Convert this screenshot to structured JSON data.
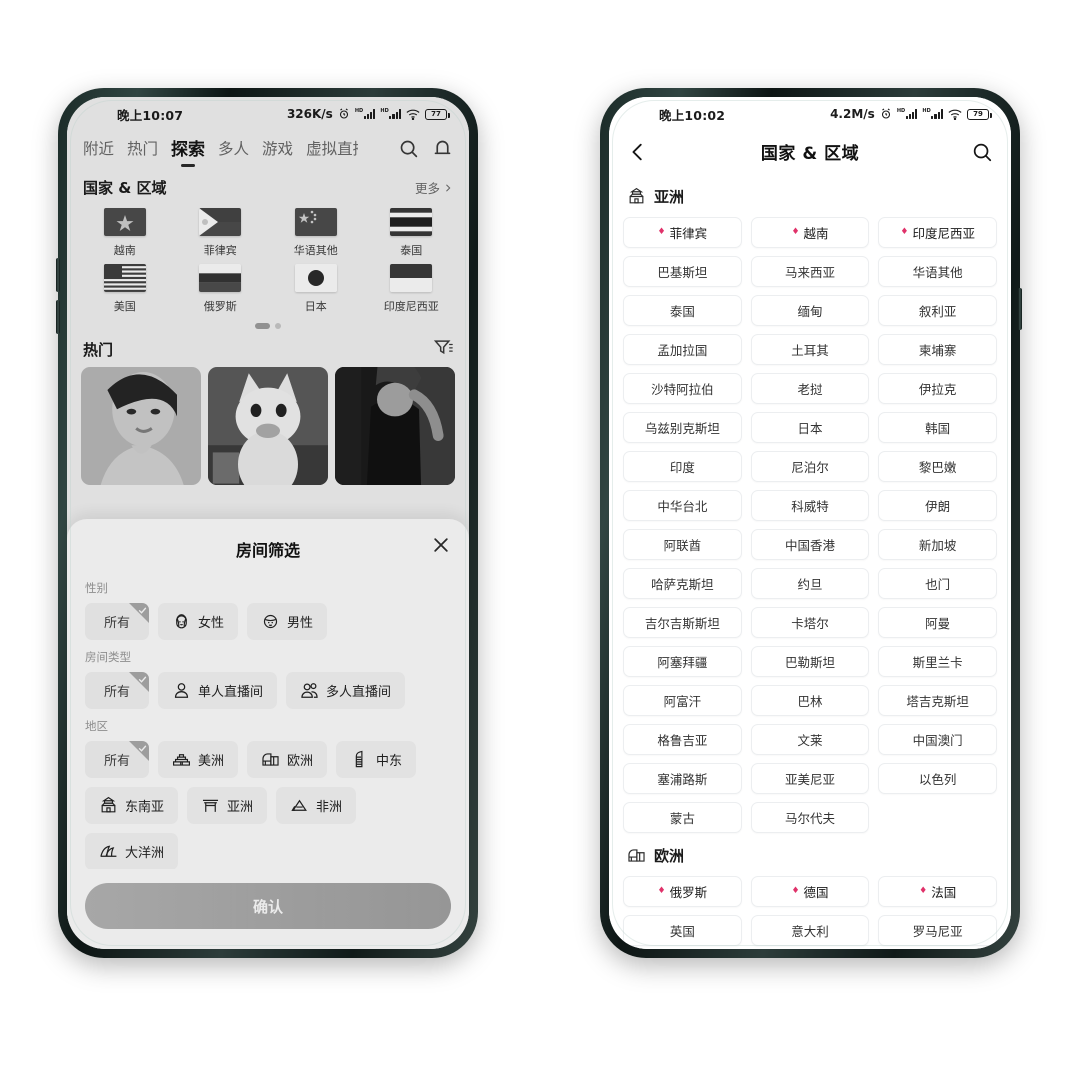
{
  "left_phone": {
    "status_bar": {
      "time": "晚上10:07",
      "network_speed": "326K/s",
      "battery": "77"
    },
    "top_nav": {
      "items": [
        {
          "label": "附近",
          "active": false
        },
        {
          "label": "热门",
          "active": false
        },
        {
          "label": "探索",
          "active": true
        },
        {
          "label": "多人",
          "active": false
        },
        {
          "label": "游戏",
          "active": false
        },
        {
          "label": "虚拟直播",
          "active": false
        }
      ],
      "search_icon": "search-icon",
      "bell_icon": "bell-icon"
    },
    "country_section": {
      "title": "国家 & 区域",
      "more_label": "更多",
      "flags": [
        {
          "label": "越南",
          "flag": "vietnam"
        },
        {
          "label": "菲律宾",
          "flag": "philippines"
        },
        {
          "label": "华语其他",
          "flag": "china"
        },
        {
          "label": "泰国",
          "flag": "thailand"
        },
        {
          "label": "美国",
          "flag": "usa"
        },
        {
          "label": "俄罗斯",
          "flag": "russia"
        },
        {
          "label": "日本",
          "flag": "japan"
        },
        {
          "label": "印度尼西亚",
          "flag": "indonesia"
        }
      ],
      "page_dots": {
        "total": 2,
        "active_index": 0
      }
    },
    "hot_section": {
      "title": "热门",
      "filter_icon": "filter-icon",
      "thumbnails": [
        "woman-yellow-shirt",
        "white-cat-meme",
        "person-dark-room"
      ]
    },
    "filter_sheet": {
      "title": "房间筛选",
      "close_icon": "close-icon",
      "groups": [
        {
          "label": "性别",
          "options": [
            {
              "label": "所有",
              "selected": true,
              "icon": null
            },
            {
              "label": "女性",
              "selected": false,
              "icon": "female-face-icon"
            },
            {
              "label": "男性",
              "selected": false,
              "icon": "male-face-icon"
            }
          ]
        },
        {
          "label": "房间类型",
          "options": [
            {
              "label": "所有",
              "selected": true,
              "icon": null
            },
            {
              "label": "单人直播间",
              "selected": false,
              "icon": "single-person-icon"
            },
            {
              "label": "多人直播间",
              "selected": false,
              "icon": "multi-person-icon"
            }
          ]
        },
        {
          "label": "地区",
          "options": [
            {
              "label": "所有",
              "selected": true,
              "icon": null
            },
            {
              "label": "美洲",
              "selected": false,
              "icon": "pyramid-icon"
            },
            {
              "label": "欧洲",
              "selected": false,
              "icon": "colosseum-icon"
            },
            {
              "label": "中东",
              "selected": false,
              "icon": "burj-icon"
            },
            {
              "label": "东南亚",
              "selected": false,
              "icon": "temple-icon"
            },
            {
              "label": "亚洲",
              "selected": false,
              "icon": "torii-icon"
            },
            {
              "label": "非洲",
              "selected": false,
              "icon": "pyramids-icon"
            },
            {
              "label": "大洋洲",
              "selected": false,
              "icon": "opera-house-icon"
            }
          ]
        }
      ],
      "confirm_label": "确认"
    }
  },
  "right_phone": {
    "status_bar": {
      "time": "晚上10:02",
      "network_speed": "4.2M/s",
      "battery": "79"
    },
    "navbar": {
      "back_icon": "chevron-left-icon",
      "title": "国家 & 区域",
      "search_icon": "search-icon"
    },
    "regions": [
      {
        "name": "亚洲",
        "icon": "temple-icon",
        "countries": [
          {
            "label": "菲律宾",
            "hot": true
          },
          {
            "label": "越南",
            "hot": true
          },
          {
            "label": "印度尼西亚",
            "hot": true
          },
          {
            "label": "巴基斯坦",
            "hot": false
          },
          {
            "label": "马来西亚",
            "hot": false
          },
          {
            "label": "华语其他",
            "hot": false
          },
          {
            "label": "泰国",
            "hot": false
          },
          {
            "label": "缅甸",
            "hot": false
          },
          {
            "label": "叙利亚",
            "hot": false
          },
          {
            "label": "孟加拉国",
            "hot": false
          },
          {
            "label": "土耳其",
            "hot": false
          },
          {
            "label": "柬埔寨",
            "hot": false
          },
          {
            "label": "沙特阿拉伯",
            "hot": false
          },
          {
            "label": "老挝",
            "hot": false
          },
          {
            "label": "伊拉克",
            "hot": false
          },
          {
            "label": "乌兹别克斯坦",
            "hot": false
          },
          {
            "label": "日本",
            "hot": false
          },
          {
            "label": "韩国",
            "hot": false
          },
          {
            "label": "印度",
            "hot": false
          },
          {
            "label": "尼泊尔",
            "hot": false
          },
          {
            "label": "黎巴嫩",
            "hot": false
          },
          {
            "label": "中华台北",
            "hot": false
          },
          {
            "label": "科威特",
            "hot": false
          },
          {
            "label": "伊朗",
            "hot": false
          },
          {
            "label": "阿联酋",
            "hot": false
          },
          {
            "label": "中国香港",
            "hot": false
          },
          {
            "label": "新加坡",
            "hot": false
          },
          {
            "label": "哈萨克斯坦",
            "hot": false
          },
          {
            "label": "约旦",
            "hot": false
          },
          {
            "label": "也门",
            "hot": false
          },
          {
            "label": "吉尔吉斯斯坦",
            "hot": false
          },
          {
            "label": "卡塔尔",
            "hot": false
          },
          {
            "label": "阿曼",
            "hot": false
          },
          {
            "label": "阿塞拜疆",
            "hot": false
          },
          {
            "label": "巴勒斯坦",
            "hot": false
          },
          {
            "label": "斯里兰卡",
            "hot": false
          },
          {
            "label": "阿富汗",
            "hot": false
          },
          {
            "label": "巴林",
            "hot": false
          },
          {
            "label": "塔吉克斯坦",
            "hot": false
          },
          {
            "label": "格鲁吉亚",
            "hot": false
          },
          {
            "label": "文莱",
            "hot": false
          },
          {
            "label": "中国澳门",
            "hot": false
          },
          {
            "label": "塞浦路斯",
            "hot": false
          },
          {
            "label": "亚美尼亚",
            "hot": false
          },
          {
            "label": "以色列",
            "hot": false
          },
          {
            "label": "蒙古",
            "hot": false
          },
          {
            "label": "马尔代夫",
            "hot": false
          }
        ]
      },
      {
        "name": "欧洲",
        "icon": "colosseum-icon",
        "countries": [
          {
            "label": "俄罗斯",
            "hot": true
          },
          {
            "label": "德国",
            "hot": true
          },
          {
            "label": "法国",
            "hot": true
          },
          {
            "label": "英国",
            "hot": false
          },
          {
            "label": "意大利",
            "hot": false
          },
          {
            "label": "罗马尼亚",
            "hot": false
          }
        ]
      }
    ]
  },
  "colors": {
    "accent_teal": "#22cfd6",
    "confirm_gradient_start": "#3fd9b6",
    "confirm_gradient_end": "#13c6ef",
    "hot_marker": "#e0326a",
    "chip_bg": "#f5f6f8",
    "chip_selected_bg": "#e2f8f8",
    "page_bg": "#ffffff",
    "phone_bezel": "#1b2b28"
  }
}
